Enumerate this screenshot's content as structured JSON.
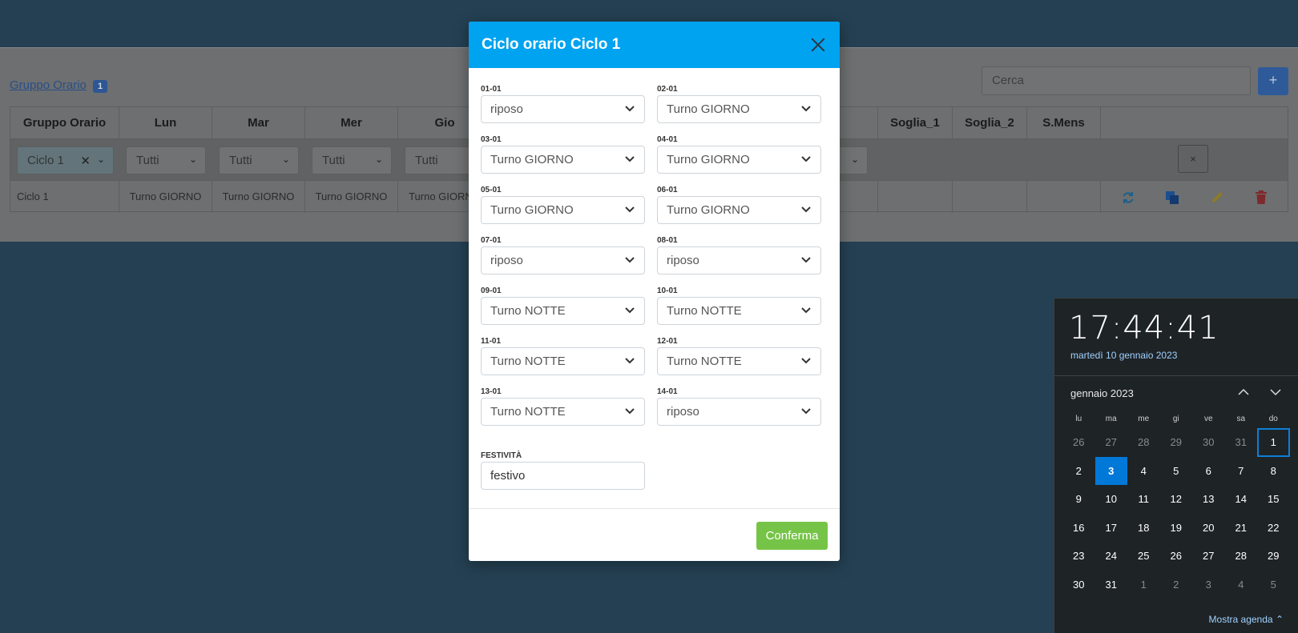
{
  "background": {
    "group_link": "Gruppo Orario",
    "group_badge": "1",
    "search_placeholder": "Cerca",
    "add_label": "+",
    "columns": [
      "Gruppo Orario",
      "Lun",
      "Mar",
      "Mer",
      "Gio",
      "Soglia_1",
      "Soglia_2",
      "S.Mens"
    ],
    "filter_group": "Ciclo 1",
    "filter_all": "Tutti",
    "clear_label": "×",
    "row": {
      "name": "Ciclo 1",
      "lun": "Turno GIORNO",
      "mar": "Turno GIORNO",
      "mer": "Turno GIORNO",
      "gio": "Turno GIORNO"
    },
    "action_colors": {
      "refresh": "#1c7db8",
      "copy": "#1f5fb0",
      "edit": "#c7a21f",
      "delete": "#b12a2e"
    }
  },
  "modal": {
    "title": "Ciclo orario Ciclo 1",
    "fields": [
      {
        "label": "01-01",
        "value": "riposo"
      },
      {
        "label": "02-01",
        "value": "Turno GIORNO"
      },
      {
        "label": "03-01",
        "value": "Turno GIORNO"
      },
      {
        "label": "04-01",
        "value": "Turno GIORNO"
      },
      {
        "label": "05-01",
        "value": "Turno GIORNO"
      },
      {
        "label": "06-01",
        "value": "Turno GIORNO"
      },
      {
        "label": "07-01",
        "value": "riposo"
      },
      {
        "label": "08-01",
        "value": "riposo"
      },
      {
        "label": "09-01",
        "value": "Turno NOTTE"
      },
      {
        "label": "10-01",
        "value": "Turno NOTTE"
      },
      {
        "label": "11-01",
        "value": "Turno NOTTE"
      },
      {
        "label": "12-01",
        "value": "Turno NOTTE"
      },
      {
        "label": "13-01",
        "value": "Turno NOTTE"
      },
      {
        "label": "14-01",
        "value": "riposo"
      }
    ],
    "holiday_label": "FESTIVITÀ",
    "holiday_value": "festivo",
    "confirm_label": "Conferma",
    "header_color": "#00a3f0",
    "confirm_color": "#76c447"
  },
  "flyout": {
    "time": "17:44:41",
    "date": "martedì 10 gennaio 2023",
    "month": "gennaio 2023",
    "weekdays": [
      "lu",
      "ma",
      "me",
      "gi",
      "ve",
      "sa",
      "do"
    ],
    "weeks": [
      [
        "26",
        "27",
        "28",
        "29",
        "30",
        "31",
        "1"
      ],
      [
        "2",
        "3",
        "4",
        "5",
        "6",
        "7",
        "8"
      ],
      [
        "9",
        "10",
        "11",
        "12",
        "13",
        "14",
        "15"
      ],
      [
        "16",
        "17",
        "18",
        "19",
        "20",
        "21",
        "22"
      ],
      [
        "23",
        "24",
        "25",
        "26",
        "27",
        "28",
        "29"
      ],
      [
        "30",
        "31",
        "1",
        "2",
        "3",
        "4",
        "5"
      ]
    ],
    "agenda_label": "Mostra agenda",
    "today_color": "#0078d7"
  }
}
